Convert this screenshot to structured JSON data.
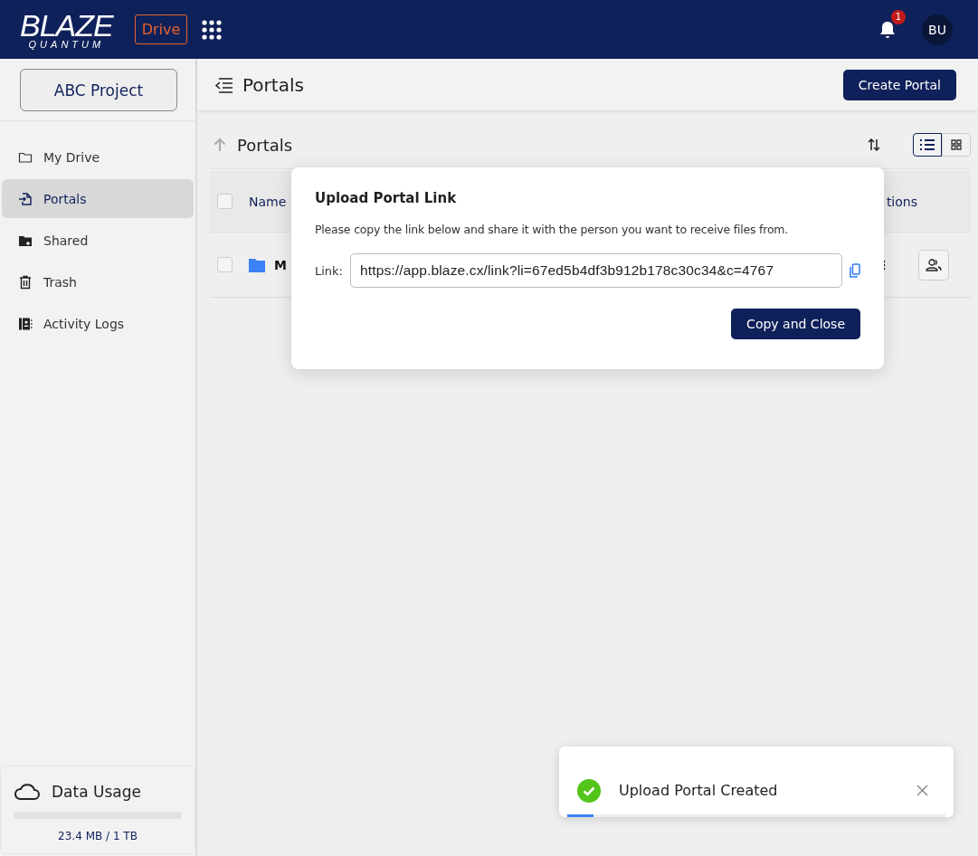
{
  "header": {
    "logo": {
      "word": "BLAZE",
      "subword": "QUANTUM"
    },
    "app_badge": "Drive",
    "notifications": {
      "count": "1"
    },
    "avatar": "BU"
  },
  "sidebar": {
    "project": "ABC Project",
    "items": [
      {
        "label": "My Drive",
        "selected": false
      },
      {
        "label": "Portals",
        "selected": true
      },
      {
        "label": "Shared",
        "selected": false
      },
      {
        "label": "Trash",
        "selected": false
      },
      {
        "label": "Activity Logs",
        "selected": false
      }
    ],
    "usage": {
      "title": "Data Usage",
      "level": 0,
      "reading": "23.4 MB / 1 TB"
    }
  },
  "toolbar": {
    "title": "Portals",
    "button": "Create Portal"
  },
  "content": {
    "breadcrumb": "Portals",
    "view_modes": [
      {
        "selected": true
      },
      {
        "selected": false
      }
    ],
    "table": {
      "columns": [
        "Name",
        "tions"
      ],
      "rows": [
        {
          "checked": false,
          "name": "M"
        }
      ]
    },
    "header_checked": false
  },
  "dialog": {
    "title": "Upload Portal Link",
    "message": "Please copy the link below and share it with the person you want to receive files from.",
    "link_label": "Link:",
    "link_value": "https://app.blaze.cx/link?li=67ed5b4df3b912b178c30c34&c=4767",
    "button": "Copy and Close"
  },
  "toast": {
    "message": "Upload Portal Created",
    "level": 0.07
  }
}
